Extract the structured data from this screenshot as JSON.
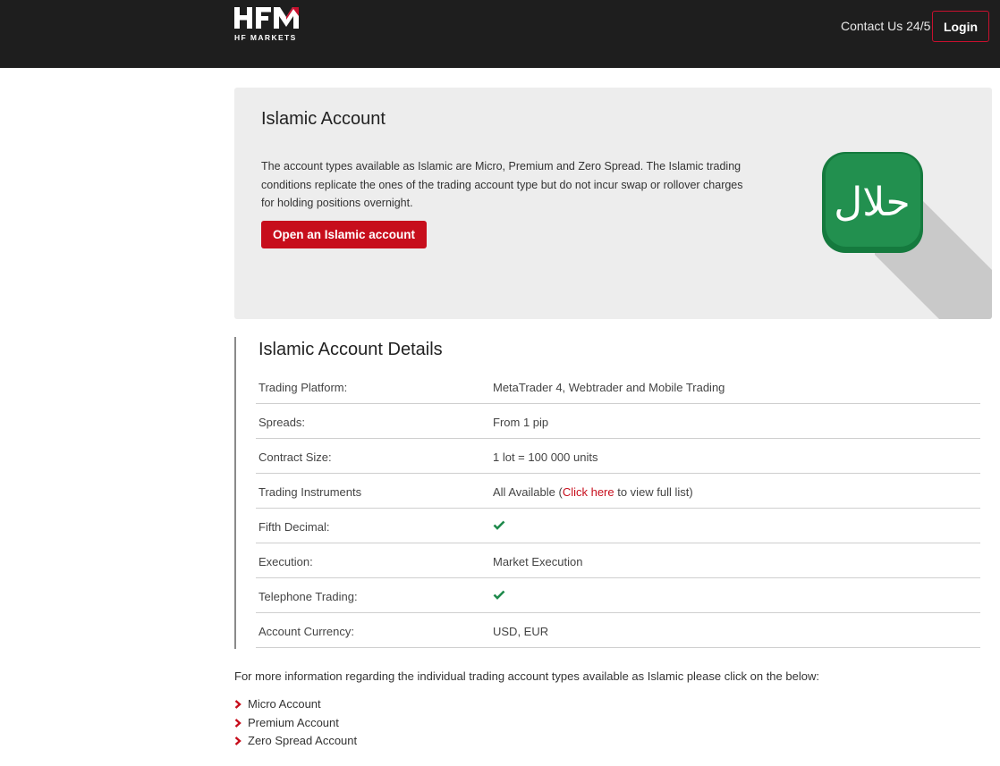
{
  "header": {
    "logo_text": "HFM",
    "logo_subtext": "HF MARKETS",
    "contact_label": "Contact Us 24/5",
    "login_label": "Login"
  },
  "hero": {
    "title": "Islamic Account",
    "description": "The account types available as Islamic are Micro, Premium and Zero Spread. The Islamic trading conditions replicate the ones of the trading account type but do not incur swap or rollover charges for holding positions overnight.",
    "button_label": "Open an Islamic account",
    "badge_icon": "halal-icon",
    "badge_text": "حلال"
  },
  "details": {
    "title": "Islamic Account Details",
    "rows": [
      {
        "label": "Trading Platform:",
        "value": "MetaTrader 4, Webtrader and Mobile Trading"
      },
      {
        "label": "Spreads:",
        "value": "From 1 pip"
      },
      {
        "label": "Contract Size:",
        "value": "1 lot = 100 000 units"
      },
      {
        "label": "Trading Instruments",
        "value_prefix": "All Available (",
        "link_text": "Click here",
        "value_suffix": " to view full list)"
      },
      {
        "label": "Fifth Decimal:",
        "value_icon": "checkmark-icon"
      },
      {
        "label": "Execution:",
        "value": "Market Execution"
      },
      {
        "label": "Telephone Trading:",
        "value_icon": "checkmark-icon"
      },
      {
        "label": "Account Currency:",
        "value": "USD, EUR"
      }
    ]
  },
  "more_info": {
    "text": "For more information regarding the individual trading account types available as Islamic please click on the below:",
    "accounts": [
      "Micro Account",
      "Premium Account",
      "Zero Spread Account"
    ]
  },
  "colors": {
    "brand_red": "#c70e1c",
    "header_bg": "#1e1e1e",
    "hero_bg": "#ededed",
    "check_green": "#1f8a4c",
    "halal_green": "#1d7f45"
  }
}
